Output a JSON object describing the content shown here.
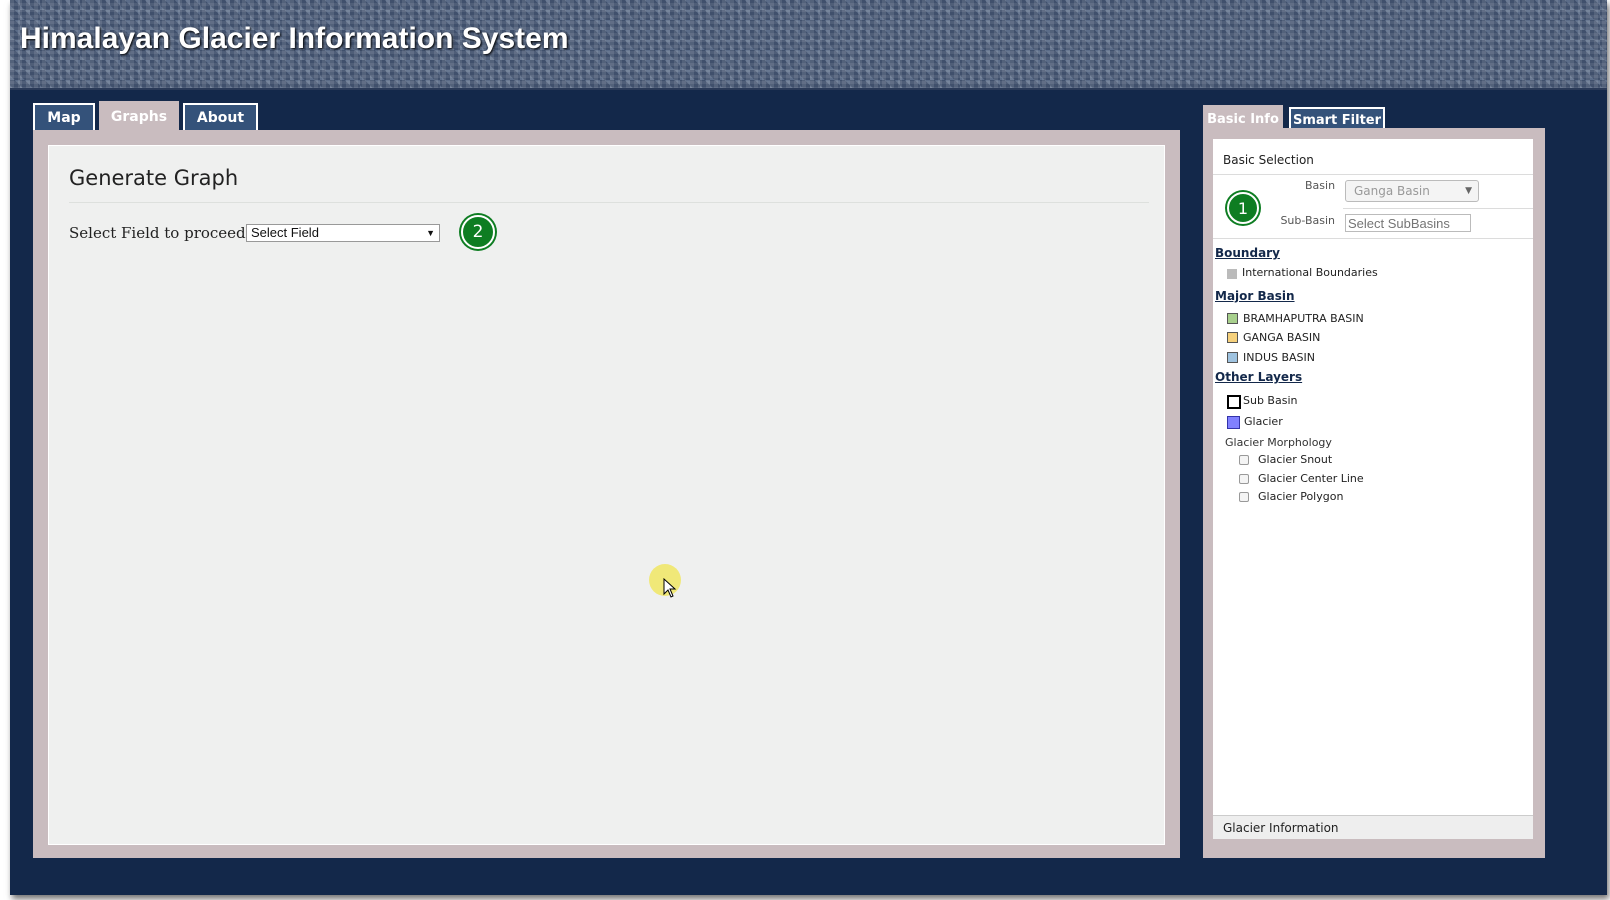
{
  "app": {
    "title": "Himalayan Glacier Information System"
  },
  "tabs": [
    {
      "label": "Map",
      "active": false
    },
    {
      "label": "Graphs",
      "active": true
    },
    {
      "label": "About",
      "active": false
    }
  ],
  "main": {
    "section_title": "Generate Graph",
    "field_label": "Select Field to proceed :",
    "field_select_value": "Select Field",
    "step_badge": "2"
  },
  "side_tabs": [
    {
      "label": "Basic Info",
      "active": true
    },
    {
      "label": "Smart Filter",
      "active": false
    }
  ],
  "basic_selection": {
    "title": "Basic Selection",
    "step_badge": "1",
    "basin_label": "Basin",
    "basin_value": "Ganga Basin",
    "subbasin_label": "Sub-Basin",
    "subbasin_placeholder": "Select SubBasins"
  },
  "legend": {
    "boundary_heading": "Boundary",
    "boundary_items": [
      "International Boundaries"
    ],
    "major_basin_heading": "Major Basin",
    "major_basins": [
      {
        "label": "BRAMHAPUTRA BASIN",
        "color": "#a8d08d"
      },
      {
        "label": "GANGA BASIN",
        "color": "#f6d17c"
      },
      {
        "label": "INDUS BASIN",
        "color": "#9fc3e0"
      }
    ],
    "other_layers_heading": "Other Layers",
    "other_layers": [
      {
        "label": "Sub Basin",
        "color": "#ffffff"
      },
      {
        "label": "Glacier",
        "color": "#8080ff"
      }
    ],
    "morphology_heading": "Glacier Morphology",
    "morphology_items": [
      "Glacier Snout",
      "Glacier Center Line",
      "Glacier Polygon"
    ]
  },
  "footer_bar": {
    "label": "Glacier Information"
  },
  "colors": {
    "frame": "#13284a",
    "tab": "#34527a",
    "tab_active": "#c9bcbf",
    "badge": "#0e7d22"
  }
}
